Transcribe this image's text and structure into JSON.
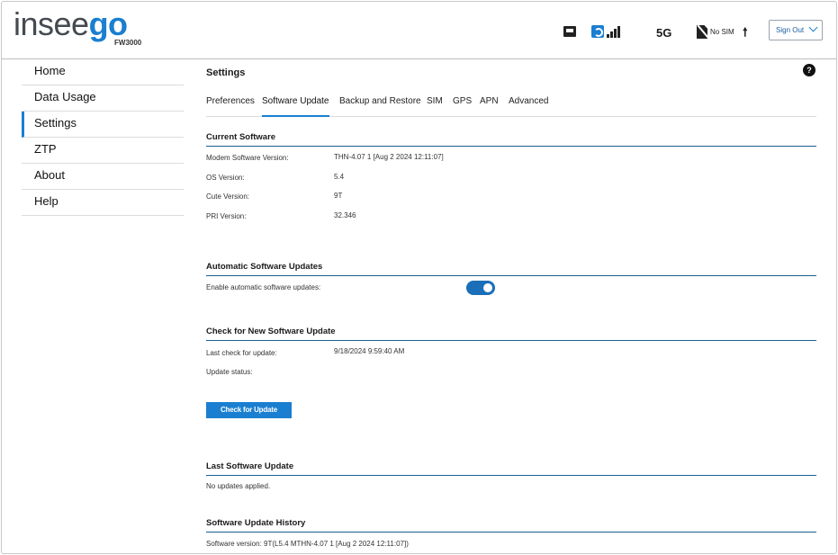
{
  "header": {
    "logo_part1": "insee",
    "logo_part2": "go",
    "model": "FW3000",
    "network_type": "5G",
    "sim_status": "No SIM",
    "sign_out_label": "Sign Out"
  },
  "icons": {
    "ethernet": "ethernet-icon",
    "wifi": "wifi-icon",
    "signal": "signal-bars-icon",
    "sim": "no-sim-icon",
    "upload": "upload-arrow-icon",
    "help": "help-icon"
  },
  "colors": {
    "brand_blue": "#1a7fd0",
    "toggle_on": "#1a6fb8"
  },
  "sidebar": {
    "items": [
      {
        "label": "Home"
      },
      {
        "label": "Data Usage"
      },
      {
        "label": "Settings"
      },
      {
        "label": "ZTP"
      },
      {
        "label": "About"
      },
      {
        "label": "Help"
      }
    ],
    "active": "Settings"
  },
  "main": {
    "title": "Settings",
    "help_glyph": "?",
    "tabs": [
      {
        "label": "Preferences"
      },
      {
        "label": "Software Update"
      },
      {
        "label": "Backup and Restore"
      },
      {
        "label": "SIM"
      },
      {
        "label": "GPS"
      },
      {
        "label": "APN"
      },
      {
        "label": "Advanced"
      }
    ],
    "active_tab": "Software Update",
    "current_software": {
      "title": "Current Software",
      "rows": [
        {
          "label": "Modem Software Version:",
          "value": "THN-4.07 1 [Aug 2 2024 12:11:07]"
        },
        {
          "label": "OS Version:",
          "value": "5.4"
        },
        {
          "label": "Cute Version:",
          "value": "9T"
        },
        {
          "label": "PRI Version:",
          "value": "32.346"
        }
      ]
    },
    "auto_updates": {
      "title": "Automatic Software Updates",
      "label": "Enable automatic software updates:",
      "enabled": true
    },
    "check_update": {
      "title": "Check for New Software Update",
      "last_check_label": "Last check for update:",
      "last_check_value": "9/18/2024 9:59:40 AM",
      "status_label": "Update status:",
      "button_label": "Check for Update"
    },
    "last_update": {
      "title": "Last Software Update",
      "text": "No updates applied."
    },
    "history": {
      "title": "Software Update History",
      "text": "Software version: 9T(L5.4 MTHN-4.07 1 [Aug 2 2024 12:11:07])"
    }
  }
}
